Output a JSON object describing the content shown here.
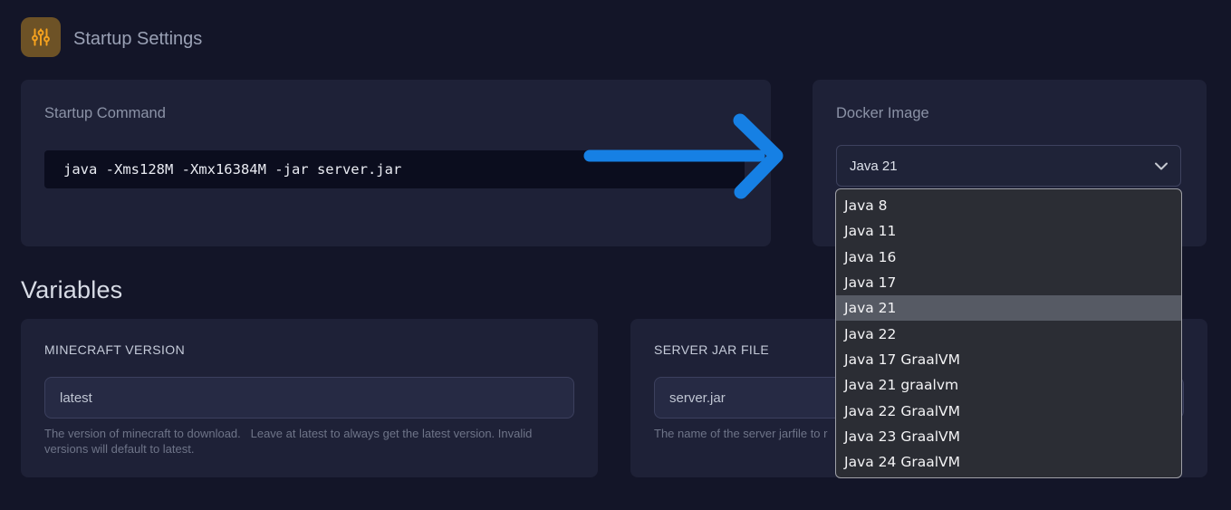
{
  "header": {
    "title": "Startup Settings",
    "icon": "sliders-icon"
  },
  "startup_command": {
    "label": "Startup Command",
    "command": "java -Xms128M -Xmx16384M -jar server.jar"
  },
  "docker_image": {
    "label": "Docker Image",
    "selected": "Java 21",
    "highlighted_index": 4,
    "options": [
      "Java 8",
      "Java 11",
      "Java 16",
      "Java 17",
      "Java 21",
      "Java 22",
      "Java 17 GraalVM",
      "Java 21 graalvm",
      "Java 22 GraalVM",
      "Java 23 GraalVM",
      "Java 24 GraalVM"
    ]
  },
  "variables": {
    "heading": "Variables",
    "items": [
      {
        "label": "MINECRAFT VERSION",
        "value": "latest",
        "description": "The version of minecraft to download.   Leave at latest to always get the latest version. Invalid versions will default to latest."
      },
      {
        "label": "SERVER JAR FILE",
        "value": "server.jar",
        "description": "The name of the server jarfile to r"
      }
    ]
  },
  "annotation": {
    "arrow_color": "#1680e4"
  },
  "colors": {
    "background": "#131528",
    "card": "#1e2137",
    "code_background": "#0b0d1e",
    "dropdown_background": "#2b2d34",
    "dropdown_highlight": "#565a64",
    "icon_orange": "#f6a21e",
    "icon_tile": "#6d5226",
    "arrow_blue": "#1680e4"
  }
}
